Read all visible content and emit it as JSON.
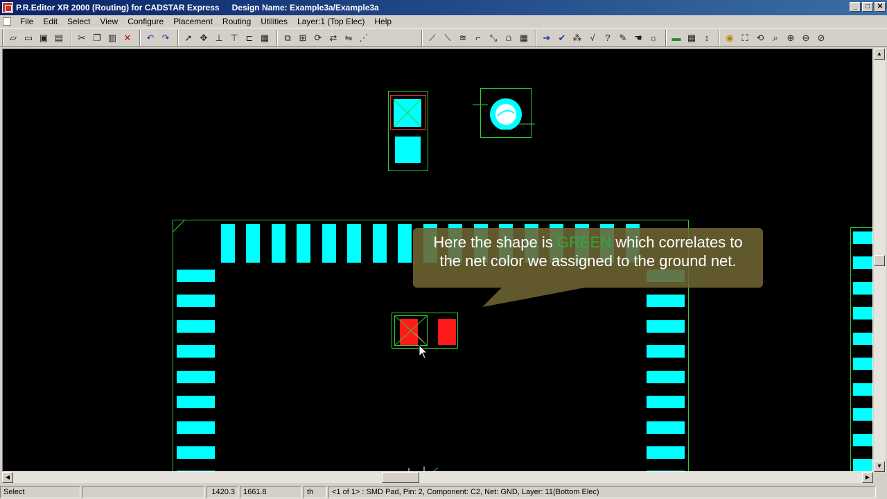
{
  "window": {
    "title": "P.R.Editor XR 2000 (Routing) for CADSTAR Express",
    "design_name": "Design Name: Example3a/Example3a",
    "min_glyph": "_",
    "max_glyph": "□",
    "close_glyph": "✕"
  },
  "menu": {
    "items": [
      "File",
      "Edit",
      "Select",
      "View",
      "Configure",
      "Placement",
      "Routing",
      "Utilities",
      "Layer:1 (Top Elec)",
      "Help"
    ]
  },
  "toolbar": {
    "groups": [
      [
        "open-icon",
        "open-folder-icon",
        "save-icon",
        "print-icon"
      ],
      [
        "cut-icon",
        "copy-icon",
        "paste-icon",
        "delete-icon"
      ],
      [
        "undo-icon",
        "redo-icon"
      ],
      [
        "select-arrow-icon",
        "move-icon",
        "dimension-icon",
        "dimension2-icon",
        "dimension3-icon",
        "grid-icon"
      ],
      [
        "place-icon",
        "align-icon",
        "rotate-icon",
        "swap-icon",
        "mirror-icon",
        "spread-icon"
      ],
      [
        "route-icon",
        "route45-icon",
        "multi-route-icon",
        "push-route-icon",
        "diagonal-icon",
        "meander-icon",
        "route-settings-icon"
      ],
      [
        "connect-icon",
        "check-icon",
        "drc-icon",
        "verify-icon",
        "query-icon",
        "measure-icon",
        "hand-icon",
        "highlight-icon"
      ],
      [
        "layers-icon",
        "table-icon",
        "stackup-icon"
      ],
      [
        "colors-icon",
        "zoom-fit-icon",
        "redraw-icon",
        "zoom-window-icon",
        "zoom-in-icon",
        "zoom-out-icon",
        "zoom-prev-icon"
      ]
    ]
  },
  "callout": {
    "line1_before": "Here the shape is ",
    "line1_green": "GREEN",
    "line1_after": " which correlates to",
    "line2": "the net color we assigned to the ground net."
  },
  "status": {
    "mode": "Select",
    "blank": "",
    "x": "1420.3",
    "y": "1661.8",
    "units": "th",
    "info": "<1 of 1> : SMD Pad, Pin: 2, Component: C2, Net: GND, Layer: 11(Bottom Elec)"
  },
  "colors": {
    "pad": "#00ffff",
    "outline": "#33cc33",
    "selected_pad": "#ff1a1a",
    "canvas": "#000000"
  }
}
